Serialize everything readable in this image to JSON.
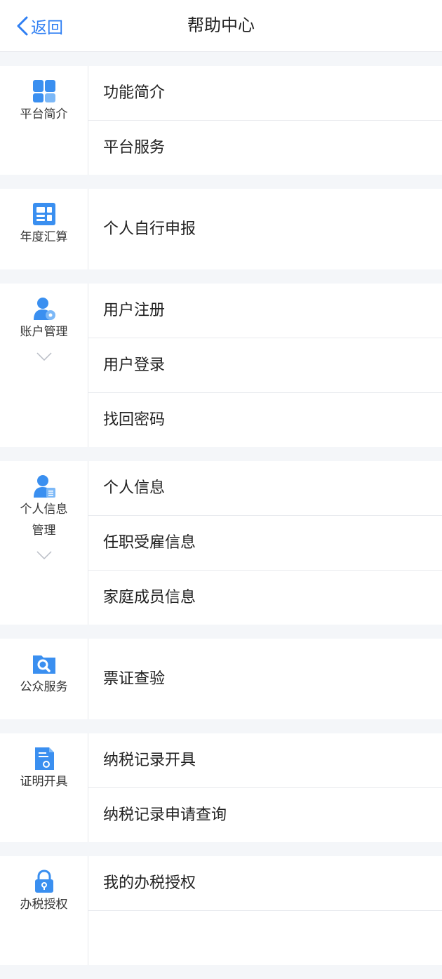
{
  "nav": {
    "back_label": "返回",
    "title": "帮助中心"
  },
  "colors": {
    "accent": "#2f7ff3",
    "icon_blue": "#3a8ff0",
    "icon_light": "#7cb8f7",
    "background": "#f4f6f9"
  },
  "sections": [
    {
      "category": "平台简介",
      "icon": "grid-icon",
      "items": [
        "功能简介",
        "平台服务"
      ]
    },
    {
      "category": "年度汇算",
      "icon": "dashboard-icon",
      "items": [
        "个人自行申报"
      ]
    },
    {
      "category": "账户管理",
      "icon": "user-gear-icon",
      "expandable": true,
      "items": [
        "用户注册",
        "用户登录",
        "找回密码"
      ]
    },
    {
      "category": "个人信息管理",
      "icon": "user-doc-icon",
      "expandable": true,
      "items": [
        "个人信息",
        "任职受雇信息",
        "家庭成员信息"
      ]
    },
    {
      "category": "公众服务",
      "icon": "folder-search-icon",
      "items": [
        "票证查验"
      ]
    },
    {
      "category": "证明开具",
      "icon": "certificate-icon",
      "items": [
        "纳税记录开具",
        "纳税记录申请查询"
      ]
    },
    {
      "category": "办税授权",
      "icon": "lock-icon",
      "items": [
        "我的办税授权"
      ]
    }
  ]
}
